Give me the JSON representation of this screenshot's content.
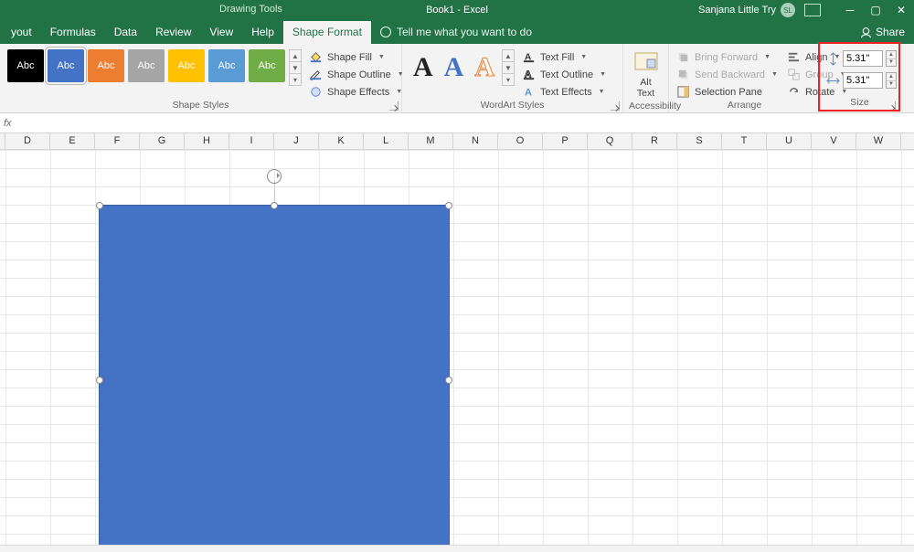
{
  "titlebar": {
    "tool_context": "Drawing Tools",
    "document": "Book1 - Excel",
    "user_name": "Sanjana Little Try",
    "user_initials": "SL"
  },
  "tabs": {
    "items": [
      "yout",
      "Formulas",
      "Data",
      "Review",
      "View",
      "Help",
      "Shape Format"
    ],
    "active_index": 6,
    "tellme": "Tell me what you want to do",
    "share": "Share"
  },
  "ribbon": {
    "shape_styles": {
      "label": "Shape Styles",
      "swatch_text": "Abc",
      "colors": [
        "#000000",
        "#4472c4",
        "#ed7d31",
        "#a5a5a5",
        "#ffc000",
        "#5b9bd5",
        "#70ad47"
      ],
      "selected": 1,
      "fill": "Shape Fill",
      "outline": "Shape Outline",
      "effects": "Shape Effects"
    },
    "wordart": {
      "label": "WordArt Styles",
      "glyph": "A",
      "text_fill": "Text Fill",
      "text_outline": "Text Outline",
      "text_effects": "Text Effects"
    },
    "accessibility": {
      "label": "Accessibility",
      "alt_text": "Alt Text"
    },
    "arrange": {
      "label": "Arrange",
      "bring_forward": "Bring Forward",
      "send_backward": "Send Backward",
      "selection_pane": "Selection Pane",
      "align": "Align",
      "group": "Group",
      "rotate": "Rotate"
    },
    "size": {
      "label": "Size",
      "height": "5.31\"",
      "width": "5.31\""
    }
  },
  "grid": {
    "columns": [
      "",
      "D",
      "E",
      "F",
      "G",
      "H",
      "I",
      "J",
      "K",
      "L",
      "M",
      "N",
      "O",
      "P",
      "Q",
      "R",
      "S",
      "T",
      "U",
      "V",
      "W"
    ]
  }
}
